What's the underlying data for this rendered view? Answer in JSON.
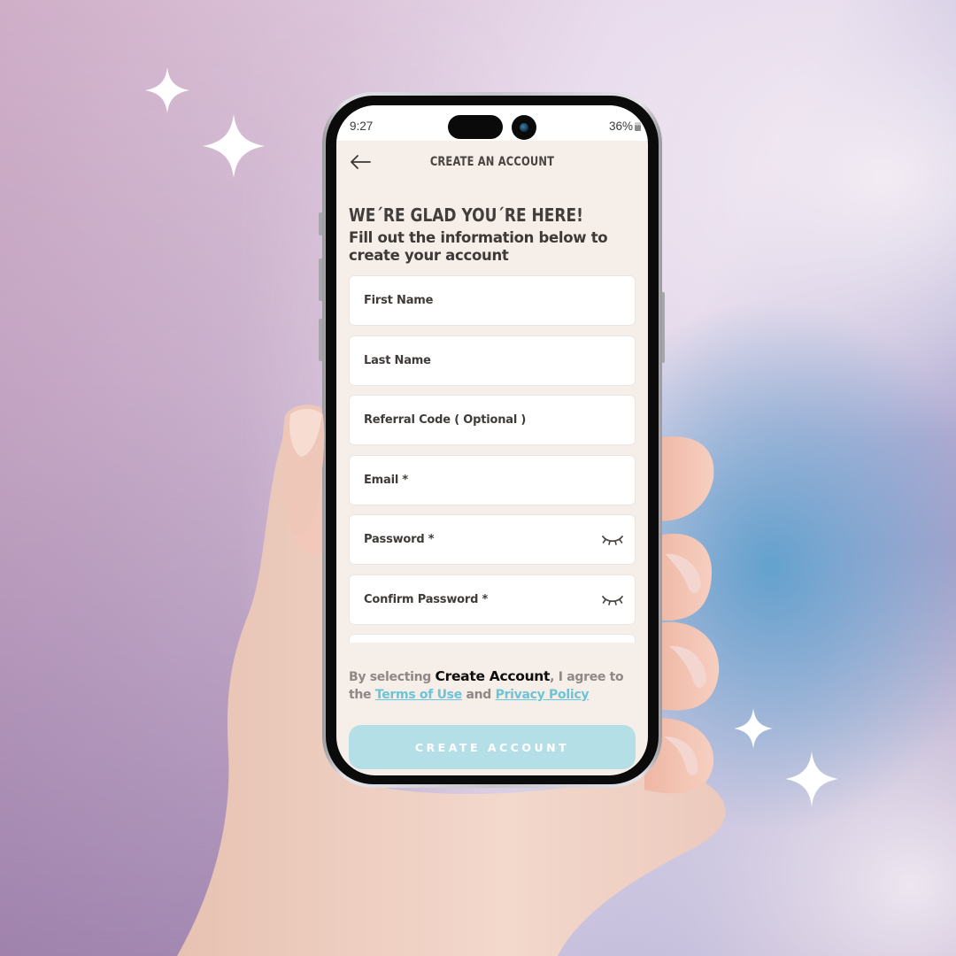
{
  "status_bar": {
    "time": "9:27",
    "battery_text": "36%"
  },
  "header": {
    "back_icon": "arrow-left-icon",
    "title": "CREATE AN ACCOUNT"
  },
  "intro": {
    "headline": "WE´RE GLAD YOU´RE HERE!",
    "subhead": "Fill out the information below to create your account"
  },
  "form": {
    "fields": [
      {
        "label": "First Name",
        "value": ""
      },
      {
        "label": "Last Name",
        "value": ""
      },
      {
        "label": "Referral Code ( Optional )",
        "value": ""
      },
      {
        "label": "Email *",
        "value": ""
      },
      {
        "label": "Password *",
        "value": "",
        "icon": "eye-closed-icon"
      },
      {
        "label": "Confirm Password *",
        "value": "",
        "icon": "eye-closed-icon"
      }
    ]
  },
  "legal": {
    "prefix": "By selecting ",
    "emphasis": "Create Account",
    "middle": ", I agree to the ",
    "terms_link": "Terms of Use",
    "and": " and ",
    "privacy_link": "Privacy Policy"
  },
  "cta": {
    "label": "CREATE ACCOUNT"
  },
  "colors": {
    "screen_background": "#f6eee9",
    "link": "#6cc4d8",
    "cta_disabled": "#b4dfe6",
    "text_dark": "#423e3c"
  },
  "decorations": {
    "sparkles": [
      "sparkle-icon",
      "sparkle-icon",
      "sparkle-icon",
      "sparkle-icon"
    ]
  }
}
